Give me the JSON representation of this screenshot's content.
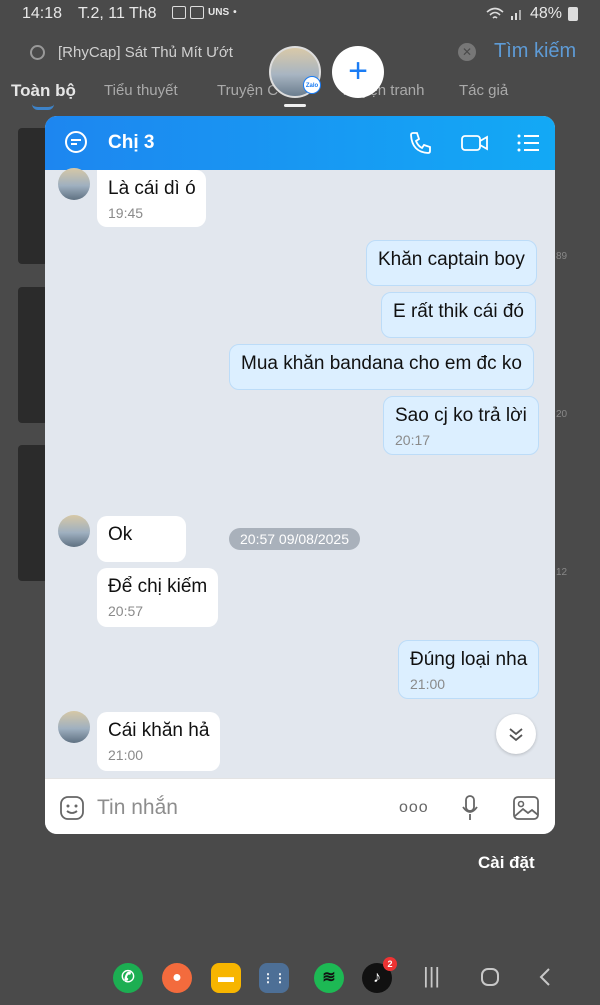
{
  "status": {
    "time": "14:18",
    "date": "T.2, 11 Th8",
    "battery": "48%",
    "notif_text": "UNS"
  },
  "background_app": {
    "search_query": "[RhyCap] Sát Thủ Mít Ướt",
    "search_button": "Tìm kiếm",
    "tabs": [
      "Toàn bộ",
      "Tiểu thuyết",
      "Truyện C",
      "Truyện tranh",
      "Tác giả"
    ],
    "counts": [
      "89",
      "20",
      "12"
    ]
  },
  "overlay": {
    "bubble_badge": "Zalo",
    "plus_label": "+"
  },
  "chat": {
    "title": "Chị 3",
    "messages": [
      {
        "from": "them",
        "text": "Là cái dì ó",
        "time": "19:45"
      },
      {
        "from": "me",
        "text": "Khăn captain boy"
      },
      {
        "from": "me",
        "text": "E rất thik cái đó"
      },
      {
        "from": "me",
        "text": "Mua khăn bandana cho em đc ko"
      },
      {
        "from": "me",
        "text": "Sao cj ko trả lời",
        "time": "20:17"
      },
      {
        "from": "them",
        "text": "Ok"
      },
      {
        "from": "them",
        "text": "Để chị kiếm",
        "time": "20:57"
      },
      {
        "from": "me",
        "text": "Đúng loại nha",
        "time": "21:00"
      },
      {
        "from": "them",
        "text": "Cái khăn hả",
        "time": "21:00"
      }
    ],
    "separator": "20:57 09/08/2025",
    "input_placeholder": "Tin nhắn",
    "more_label": "ooo"
  },
  "settings_label": "Cài đặt",
  "dock": {
    "tiktok_badge": "2"
  },
  "colors": {
    "header_start": "#1d86f0",
    "header_end": "#13a9f5",
    "my_bubble": "#dcefff",
    "chat_bg": "#e2e7ee"
  }
}
